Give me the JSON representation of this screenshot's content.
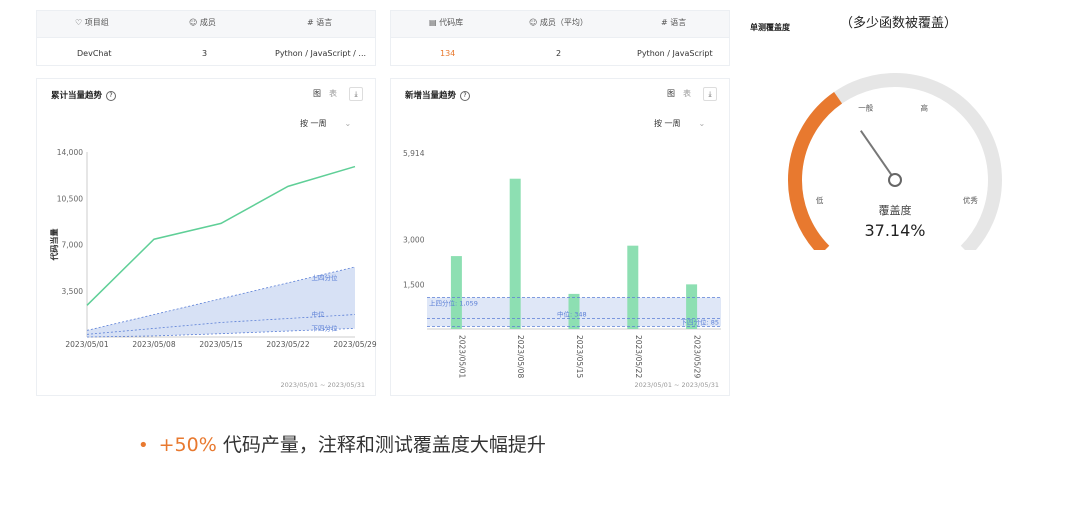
{
  "table1": {
    "headers": [
      "项目组",
      "成员",
      "语言"
    ],
    "row": [
      "DevChat",
      "3",
      "Python / JavaScript / ..."
    ]
  },
  "table2": {
    "headers": [
      "代码库",
      "成员（平均）",
      "语言"
    ],
    "row": [
      "134",
      "2",
      "Python / JavaScript"
    ]
  },
  "card1": {
    "title": "累计当量趋势",
    "toggle": [
      "图",
      "表"
    ],
    "period": "按 一周",
    "ylabel": "代码当量",
    "date_range": "2023/05/01 ~ 2023/05/31"
  },
  "card2": {
    "title": "新增当量趋势",
    "toggle": [
      "图",
      "表"
    ],
    "period": "按 一周",
    "date_range": "2023/05/01 ~ 2023/05/31"
  },
  "gauge": {
    "annotation": "（多少函数被覆盖）",
    "title": "单测覆盖度",
    "labels": [
      "低",
      "一般",
      "高",
      "优秀"
    ],
    "caption": "覆盖度",
    "value_text": "37.14%",
    "value": 0.3714
  },
  "bullet": {
    "highlight": "+50%",
    "text": " 代码产量，注释和测试覆盖度大幅提升"
  },
  "colors": {
    "accent": "#e8792f",
    "line": "#5fcf97",
    "bar": "#8ddfb2",
    "band": "#c9d7f2",
    "quartile": "#5b7fd6",
    "gauge_track": "#e6e6e6"
  },
  "chart_data": [
    {
      "type": "line",
      "x": [
        "2023/05/01",
        "2023/05/08",
        "2023/05/15",
        "2023/05/22",
        "2023/05/29"
      ],
      "ylim": [
        0,
        14000
      ],
      "yticks": [
        "3,500",
        "7,000",
        "10,500",
        "14,000"
      ],
      "series": [
        {
          "values": [
            2400,
            7400,
            8600,
            11400,
            12900
          ]
        },
        {
          "name": "上四分位",
          "values": [
            500,
            1700,
            2900,
            4100,
            5300
          ]
        },
        {
          "name": "中位",
          "values": [
            200,
            650,
            1100,
            1400,
            1700
          ]
        },
        {
          "name": "下四分位",
          "values": [
            0,
            80,
            250,
            450,
            650
          ]
        }
      ],
      "band_labels": [
        "上四分位",
        "中位",
        "下四分位"
      ]
    },
    {
      "type": "bar",
      "categories": [
        "2023/05/01",
        "2023/05/08",
        "2023/05/15",
        "2023/05/22",
        "2023/05/29"
      ],
      "values": [
        2450,
        5050,
        1180,
        2800,
        1500
      ],
      "ytick_labels": [
        "1,500",
        "3,000",
        "5,914"
      ],
      "yticks": [
        1500,
        3000,
        5914
      ],
      "ylim": [
        0,
        5914
      ],
      "reference_lines": [
        {
          "label": "上四分位: 1,059",
          "value": 1059
        },
        {
          "label": "中位: 348",
          "value": 348
        },
        {
          "label": "下四分位: 85",
          "value": 85
        }
      ]
    }
  ]
}
